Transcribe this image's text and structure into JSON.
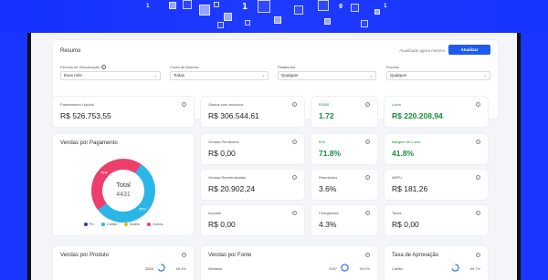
{
  "banner": {
    "digits": [
      "1",
      "1",
      "0",
      "1"
    ]
  },
  "summary": {
    "title": "Resumo",
    "updated_text": "Atualizado agora mesmo",
    "update_button": "Atualizar",
    "filters": [
      {
        "label": "Período de Visualização",
        "value": "Esse mês"
      },
      {
        "label": "Conta de Anúncio",
        "value": "Todas"
      },
      {
        "label": "Plataforma",
        "value": "Qualquer"
      },
      {
        "label": "Produto",
        "value": "Qualquer"
      }
    ]
  },
  "cards": {
    "faturamento": {
      "label": "Faturamento Líquido",
      "value": "R$ 526.753,55"
    },
    "gastos": {
      "label": "Gastos com anúncios",
      "value": "R$ 306.544,61"
    },
    "roas": {
      "label": "ROAS",
      "value": "1.72"
    },
    "lucro": {
      "label": "Lucro",
      "value": "R$ 220.208,94"
    },
    "vendas_pendentes": {
      "label": "Vendas Pendentes",
      "value": "R$ 0,00"
    },
    "roi": {
      "label": "ROI",
      "value": "71.8%"
    },
    "margem": {
      "label": "Margem de Lucro",
      "value": "41.8%"
    },
    "vendas_reembolsadas": {
      "label": "Vendas Reembolsadas",
      "value": "R$ 20.902,24"
    },
    "reembolso": {
      "label": "Reembolso",
      "value": "3.6%"
    },
    "arpu": {
      "label": "ARPU",
      "value": "R$ 181,26"
    },
    "imposto": {
      "label": "Imposto",
      "value": "R$ 0,00"
    },
    "chargeback": {
      "label": "Chargeback",
      "value": "4.3%"
    },
    "taxas": {
      "label": "Taxas",
      "value": "R$ 0,00"
    }
  },
  "payment": {
    "title": "Vendas por Pagamento",
    "total_label": "Total",
    "total_value": "4431",
    "slices": [
      {
        "name": "Pix",
        "value": 0,
        "color": "#1b3fb8"
      },
      {
        "name": "Cartão",
        "value": 55,
        "color": "#2bb6e8"
      },
      {
        "name": "Boleto",
        "value": 0,
        "color": "#f2b705"
      },
      {
        "name": "Outros",
        "value": 45,
        "color": "#ec3f6b"
      }
    ],
    "slice_labels": [
      "55%",
      "45%"
    ]
  },
  "bottom": {
    "produto": {
      "title": "Vendas por Produto",
      "count": "2806",
      "pct": "65.4%"
    },
    "fonte": {
      "title": "Vendas por Fonte",
      "row_label": "Metaads",
      "count": "4397",
      "pct": "99.0%"
    },
    "aprovacao": {
      "title": "Taxa de Aprovação",
      "row_label": "Cartão",
      "pct": "69.7%"
    }
  },
  "colors": {
    "accent": "#1f5bf0",
    "positive": "#16903a",
    "banner": "#1a35ff"
  }
}
